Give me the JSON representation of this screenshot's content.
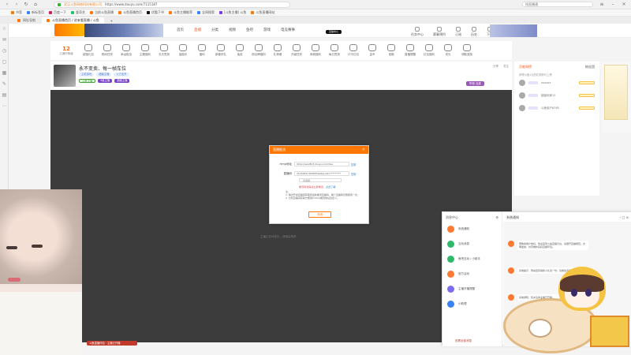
{
  "browser": {
    "url_site": "武汉斗鱼网络科技有限公司",
    "url_text": "https://www.douyu.com/7115187",
    "search_placeholder": "找直播通",
    "bookmarks": [
      "书签",
      "新标签页",
      "百度一下",
      "爱奇艺",
      "当前斗鱼直播",
      "斗鱼直播首页",
      "优酷下书",
      "斗鱼主播推荐",
      "全网搜索",
      "[斗鱼主播] 斗鱼",
      "斗鱼直播网站"
    ],
    "tabs": [
      "网址导航",
      "斗鱼直播首页 / 进来看直播 / 斗鱼"
    ],
    "new_tab": "+"
  },
  "site": {
    "nav": [
      "首页",
      "直播",
      "分类",
      "视频",
      "鱼吧",
      "游戏",
      "电竞赛事"
    ],
    "live_badge": "直播中心",
    "header_right": [
      "任务中心",
      "赛事预约",
      "订阅",
      "历史",
      "下载"
    ]
  },
  "toolbar": {
    "level": "12",
    "level_sub": "占满的等级",
    "items": [
      "超值礼包",
      "畅玩任务",
      "幸运挑战",
      "主题福利",
      "天天签到",
      "抽抽乐",
      "福利",
      "新春好礼",
      "抽奖",
      "粉丝牌福利",
      "礼物墙",
      "升级任务",
      "商城福利",
      "每日签到",
      "口令红包",
      "金币",
      "宝箱",
      "直播提醒",
      "红包福利",
      "成长",
      "领取奖励"
    ]
  },
  "streamer": {
    "title": "永不变卖、每一帧车位",
    "room_label": "房间",
    "category": "主机游戏",
    "tags": [
      "超级主播",
      "火力全开"
    ],
    "tags2": [
      "斗鱼主播",
      "9级主播",
      "超级主播"
    ],
    "right_stats": [
      "分享",
      "关注"
    ],
    "report": "举报 连麦"
  },
  "player": {
    "overlay_text": "主播正在休息中，请稍后再来"
  },
  "rank": {
    "tabs": [
      "贡献周榜",
      "粉丝团"
    ],
    "note": "获得价值1元的礼物即可上榜",
    "rows": [
      "xxxxxx",
      "超级玩家11",
      "斗鱼用户8765"
    ]
  },
  "modal": {
    "title": "直播推流",
    "close": "×",
    "rtmp_label": "rtmp地址",
    "rtmp_value": "rtmp://sendtc3.douyu.com/live",
    "copy1": "复制",
    "key_label": "直播码",
    "key_value": "7115187rr0t45H?wsSecret=*********",
    "copy2": "复制",
    "select_value": "- 请选择 -",
    "warning": "推流码泄露请立即重置，",
    "warning_link": "点此了解",
    "notes": [
      "注：",
      "1. 每次开启直播间获取到最新推流直播码，每个直播码仅限使用一次。",
      "2. 已有直播间获取方便用户rtmp推流地址自定义。"
    ],
    "button": "关闭"
  },
  "chat": {
    "left_title": "消息中心",
    "items": [
      "系统通知",
      "互动消息",
      "鱼吧互动 / 小助手",
      "官方活动",
      "主播开播提醒",
      "小助理"
    ],
    "footer": "查看全部消息",
    "right_title": "系统通知",
    "messages": [
      "尊敬的用户你好，欢迎来到斗鱼直播平台，请遵守直播规范，文明发言，共同维护良好直播环境。",
      "系统提示：恭喜您获得新人礼包一份，请前往背包查看。",
      "系统通知：您关注的主播已开播。",
      "活动通知：春节福利已上线。"
    ]
  },
  "bottom_tag": "斗鱼直播伴侣 · 主播已开播"
}
